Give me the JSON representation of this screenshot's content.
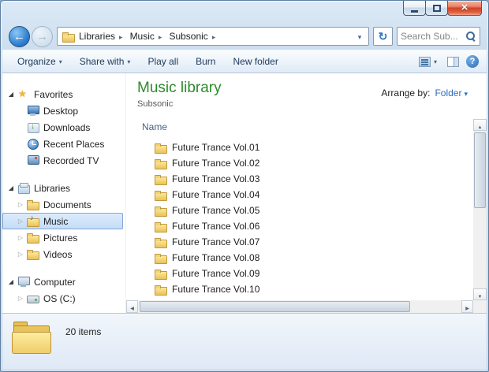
{
  "window": {
    "controls": [
      {
        "name": "minimize"
      },
      {
        "name": "maximize"
      },
      {
        "name": "close"
      }
    ]
  },
  "navbar": {
    "breadcrumb": [
      "Libraries",
      "Music",
      "Subsonic"
    ],
    "search_placeholder": "Search Sub...",
    "icons": {
      "back": "arrow-left",
      "forward": "arrow-right",
      "location": "folder",
      "address_dropdown": "chevron-down",
      "refresh": "refresh-arrows",
      "search": "magnifier"
    }
  },
  "toolbar": {
    "buttons": [
      {
        "label": "Organize",
        "dropdown": true
      },
      {
        "label": "Share with",
        "dropdown": true
      },
      {
        "label": "Play all",
        "dropdown": false
      },
      {
        "label": "Burn",
        "dropdown": false
      },
      {
        "label": "New folder",
        "dropdown": false
      }
    ],
    "right_icons": [
      "views",
      "preview-pane",
      "help"
    ]
  },
  "sidebar": {
    "sections": [
      {
        "label": "Favorites",
        "icon": "favorites-star",
        "expanded": true,
        "items": [
          {
            "label": "Desktop",
            "icon": "desktop"
          },
          {
            "label": "Downloads",
            "icon": "downloads"
          },
          {
            "label": "Recent Places",
            "icon": "recent-places"
          },
          {
            "label": "Recorded TV",
            "icon": "recorded-tv"
          }
        ]
      },
      {
        "label": "Libraries",
        "icon": "libraries",
        "expanded": true,
        "items": [
          {
            "label": "Documents",
            "icon": "documents",
            "expander": "collapsed"
          },
          {
            "label": "Music",
            "icon": "music",
            "expander": "collapsed",
            "selected": true
          },
          {
            "label": "Pictures",
            "icon": "pictures",
            "expander": "collapsed"
          },
          {
            "label": "Videos",
            "icon": "videos",
            "expander": "collapsed"
          }
        ]
      },
      {
        "label": "Computer",
        "icon": "computer",
        "expanded": true,
        "items": [
          {
            "label": "OS (C:)",
            "icon": "disk-drive",
            "expander": "collapsed"
          }
        ]
      }
    ]
  },
  "content": {
    "title": "Music library",
    "subtitle": "Subsonic",
    "arrange_by": {
      "label": "Arrange by:",
      "value": "Folder"
    },
    "columns": [
      "Name"
    ],
    "folders": [
      "Future Trance Vol.01",
      "Future Trance Vol.02",
      "Future Trance Vol.03",
      "Future Trance Vol.04",
      "Future Trance Vol.05",
      "Future Trance Vol.06",
      "Future Trance Vol.07",
      "Future Trance Vol.08",
      "Future Trance Vol.09",
      "Future Trance Vol.10"
    ]
  },
  "details_pane": {
    "item_count": "20 items"
  },
  "colors": {
    "title_green": "#2c8c2c",
    "accent_blue": "#2a6cc4",
    "close_button_red": "#ce4325",
    "selection_border": "#84a7d3"
  }
}
